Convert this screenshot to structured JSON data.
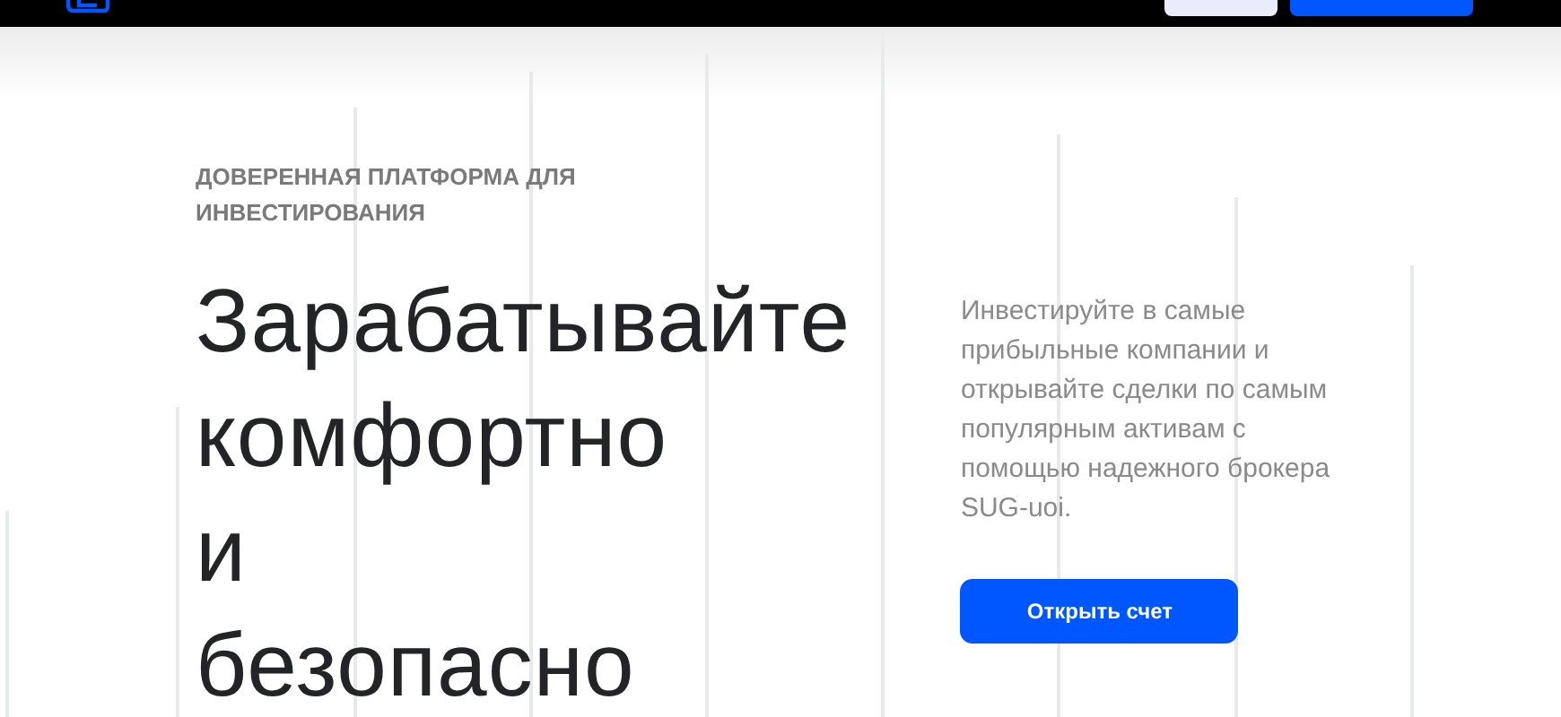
{
  "hero": {
    "eyebrow": "ДОВЕРЕННАЯ ПЛАТФОРМА ДЛЯ ИНВЕСТИРОВАНИЯ",
    "heading_lines": [
      "Зарабатывайте",
      "комфортно",
      "и",
      "безопасно"
    ],
    "description": "Инвестируйте в самые прибыльные компании и открывайте сделки по самым популярным активам с помощью надежного брокера SUG-uoi.",
    "cta": "Открыть счет"
  }
}
